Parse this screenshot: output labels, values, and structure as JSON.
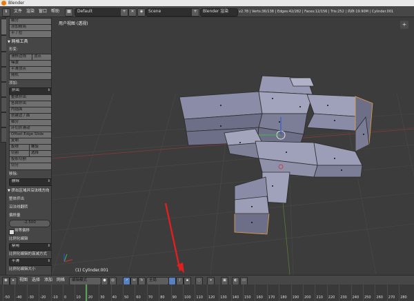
{
  "window": {
    "title": "Blender"
  },
  "header": {
    "menus": [
      "文件",
      "渲染",
      "窗口",
      "帮助"
    ],
    "layout": "Default",
    "scene": "Scene",
    "engine": "Blender 渲染",
    "stats": "v2.78 | Verts:36/138 | Edges:42/282 | Faces:12/156 | Tris:252 | 内存:19.90M | Cylinder.001"
  },
  "tool_tabs": [
    "工具",
    "创建",
    "关系",
    "动画",
    "物理",
    "着色",
    "选项",
    "油笔"
  ],
  "shelf": {
    "top_buttons": [
      "细分",
      "添加精简",
      "平 / 拉"
    ],
    "mesh_tools_title": "网格工具",
    "deform_label": "形变:",
    "deform_buttons": [
      "滑移边线",
      "顶点",
      "噪波",
      "平滑顶点",
      "随机"
    ],
    "add_label": "添加:",
    "extrude_dropdown": "挤出",
    "add_buttons": [
      "整体挤出",
      "各自挤出",
      "内插面",
      "创建边 / 面",
      "细分",
      "环切并滑动",
      "Offset Edge Slide",
      "复制"
    ],
    "spin_pair": [
      "旋绕",
      "螺旋"
    ],
    "knife_pair": [
      "切割",
      "选择"
    ],
    "knife_project": "投影切割",
    "bisect": "切分",
    "remove_label": "移除:",
    "remove_dropdown": "删除",
    "op_panel_title": "挤出区域并沿法线方向",
    "op_labels": [
      "整体挤出",
      "沿法线翻转"
    ],
    "offset_label": "偏移量",
    "offset_value": "-2.500",
    "single_side": "用等偏移",
    "proportional_label": "比例化编辑",
    "proportional_value": "禁用",
    "falloff_label": "比例化编辑的衰减方式",
    "falloff_value": "平滑",
    "size_label": "比例化编辑大小"
  },
  "viewport": {
    "view_name": "用户视图 (透视)",
    "object_label": "(1) Cylinder.001",
    "watermark": "www.xz7.com"
  },
  "footer": {
    "menus": [
      "视图",
      "选择",
      "添加",
      "网格"
    ],
    "mode": "编辑模式",
    "pivot": "全局"
  },
  "timeline": {
    "labels": [
      "-50",
      "-40",
      "-30",
      "-20",
      "-10",
      "0",
      "10",
      "20",
      "30",
      "40",
      "50",
      "60",
      "70",
      "80",
      "90",
      "100",
      "110",
      "120",
      "130",
      "140",
      "150",
      "160",
      "170",
      "180",
      "190",
      "200",
      "210",
      "220",
      "230",
      "240",
      "250",
      "260",
      "270",
      "280"
    ],
    "current_frame": "1"
  },
  "colors": {
    "selection": "#e8a040",
    "accent": "#5680c2",
    "annotation_arrow": "#e02020"
  }
}
